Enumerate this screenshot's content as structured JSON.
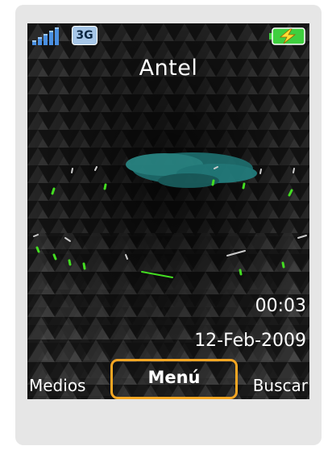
{
  "status": {
    "network_type": "3G",
    "signal_icon": "signal-strength-icon",
    "battery_icon": "battery-charging-icon"
  },
  "home": {
    "operator": "Antel",
    "time": "00:03",
    "date": "12-Feb-2009"
  },
  "softkeys": {
    "left": "Medios",
    "center": "Menú",
    "right": "Buscar"
  },
  "colors": {
    "highlight": "#f5a623",
    "battery": "#3fcf3f",
    "network_badge": "#a7c7e8"
  }
}
